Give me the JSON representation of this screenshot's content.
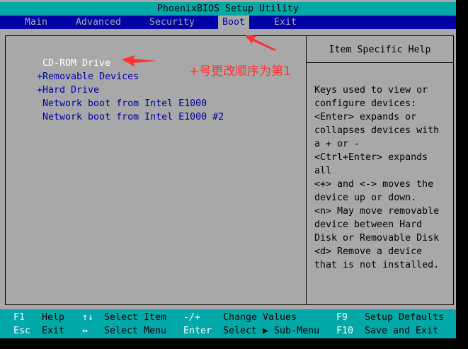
{
  "title": "PhoenixBIOS Setup Utility",
  "menu": [
    {
      "label": "Main"
    },
    {
      "label": "Advanced"
    },
    {
      "label": "Security"
    },
    {
      "label": "Boot",
      "active": true
    },
    {
      "label": "Exit"
    }
  ],
  "boot_items": [
    {
      "label": " CD-ROM Drive",
      "selected": true
    },
    {
      "label": "+Removable Devices"
    },
    {
      "label": "+Hard Drive"
    },
    {
      "label": " Network boot from Intel E1000"
    },
    {
      "label": " Network boot from Intel E1000 #2"
    }
  ],
  "help": {
    "title": "Item Specific Help",
    "lines": [
      "Keys used to view or",
      "configure devices:",
      "<Enter> expands or",
      "collapses devices with",
      "a + or -",
      "<Ctrl+Enter> expands",
      "all",
      "<+> and <-> moves the",
      "device up or down.",
      "<n> May move removable",
      "device between Hard",
      "Disk or Removable Disk",
      "<d> Remove a device",
      "that is not installed."
    ]
  },
  "footer": {
    "row1": [
      {
        "key": "F1",
        "desc": "Help"
      },
      {
        "key": "↑↓",
        "desc": "Select Item"
      },
      {
        "key": "-/+",
        "desc": "Change Values"
      },
      {
        "key": "F9",
        "desc": "Setup Defaults"
      }
    ],
    "row2": [
      {
        "key": "Esc",
        "desc": "Exit"
      },
      {
        "key": "↔",
        "desc": "Select Menu"
      },
      {
        "key": "Enter",
        "desc": "Select ▶ Sub-Menu"
      },
      {
        "key": "F10",
        "desc": "Save and Exit"
      }
    ]
  },
  "annotation": {
    "text": "+号更改顺序为第1",
    "color": "#ff3333"
  },
  "colors": {
    "title_bg": "#00a8a8",
    "menu_bg": "#0000a8",
    "body_bg": "#a8a8a8",
    "item_text": "#0000a8",
    "selected_text": "#ffffff"
  }
}
